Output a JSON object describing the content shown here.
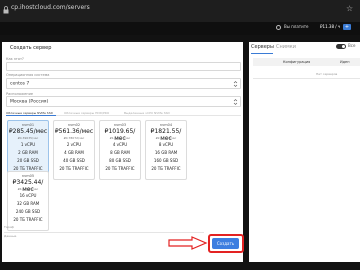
{
  "browser": {
    "url": "cp.ihostcloud.com/servers"
  },
  "header": {
    "balance_label": "Вы платите",
    "balance_value": "₽11.38 / ч",
    "add_balance": "+"
  },
  "form": {
    "title": "Создать сервер",
    "name_label": "Как этот?",
    "os_label": "Операционная система",
    "os_value": "centos 7",
    "location_label": "Расположение",
    "location_value": "Москва (Россия)",
    "tabs": [
      "Облачные серверы NVMe SSD",
      "Облачные серверы HDD/PRO",
      "Выделенные vCPU NVMe SSD"
    ],
    "plans": [
      {
        "name": "nvm01",
        "price": "₽285.45/мес",
        "hour": "₽0.39635/час",
        "cpu": "1 vCPU",
        "ram": "2 GB RAM",
        "disk": "20 GB SSD",
        "traffic": "20 ТБ TRAFFIC",
        "selected": true
      },
      {
        "name": "nvm02",
        "price": "₽561.36/мес",
        "hour": "₽0.78072/час",
        "cpu": "2 vCPU",
        "ram": "4 GB RAM",
        "disk": "40 GB SSD",
        "traffic": "20 ТБ TRAFFIC",
        "selected": false
      },
      {
        "name": "nvm03",
        "price": "₽1019.65/мес",
        "hour": "₽1.41627/час",
        "cpu": "4 vCPU",
        "ram": "8 GB RAM",
        "disk": "80 GB SSD",
        "traffic": "20 ТБ TRAFFIC",
        "selected": false
      },
      {
        "name": "nvm04",
        "price": "₽1821.55/мес",
        "hour": "₽2.53190/час",
        "cpu": "8 vCPU",
        "ram": "16 GB RAM",
        "disk": "160 GB SSD",
        "traffic": "20 ТБ TRAFFIC",
        "selected": false
      },
      {
        "name": "nvm05",
        "price": "₽3425.44/мес",
        "hour": "₽4.47555/час",
        "cpu": "16 vCPU",
        "ram": "32 GB RAM",
        "disk": "240 GB SSD",
        "traffic": "20 ТБ TRAFFIC",
        "selected": false
      }
    ],
    "tariff_note": "Тариф",
    "footer_text": "Данные",
    "submit_label": "Создать"
  },
  "side": {
    "tabs": [
      "Серверы",
      "Снимки"
    ],
    "toggle_label": "Все",
    "columns": [
      "Конфигурация",
      "Иден"
    ],
    "empty_text": "Нет серверов",
    "toggle_on": true
  },
  "colors": {
    "accent": "#3d7ee0",
    "highlight": "#e32222",
    "selected_plan": "#e6f1fb"
  }
}
